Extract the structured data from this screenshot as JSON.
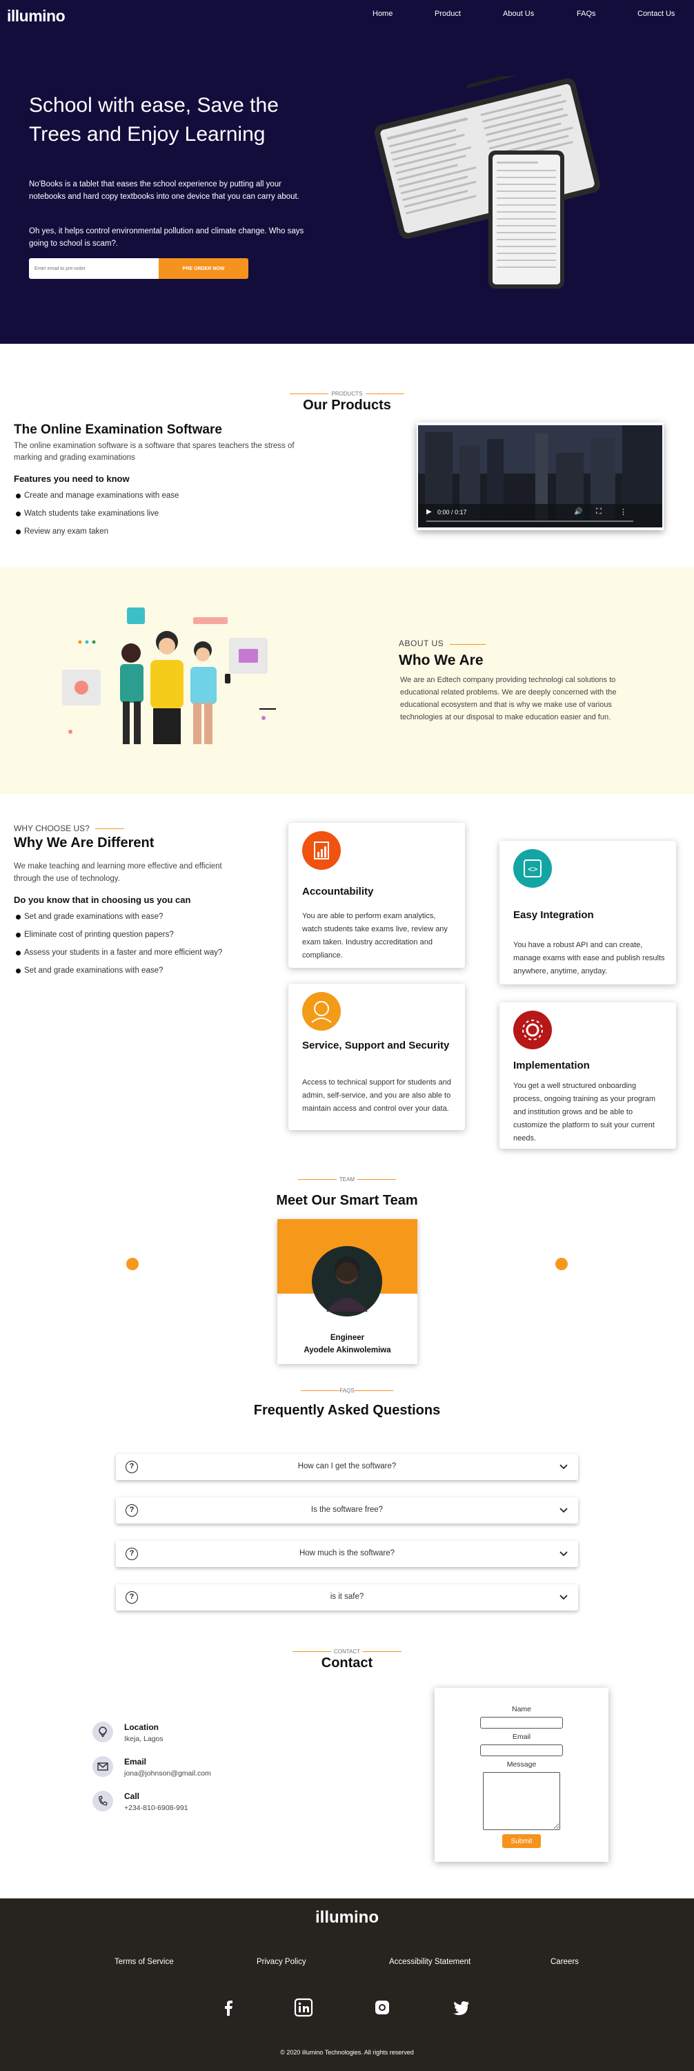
{
  "nav": {
    "logo": "illumino",
    "links": [
      "Home",
      "Product",
      "About Us",
      "FAQs",
      "Contact Us"
    ]
  },
  "hero": {
    "title": "School with ease, Save the Trees and Enjoy Learning",
    "paragraph1": "No'Books is a tablet that eases the school experience by putting all your notebooks and hard copy textbooks into one device that you can carry about.",
    "paragraph2": "Oh yes, it helps control environmental pollution and climate change. Who says going to school is scam?.",
    "input_placeholder": "Enter email to pre-order",
    "button_label": "PRE ORDER NOW"
  },
  "products": {
    "small": "PRODUCTS",
    "title": "Our Products",
    "heading": "The Online Examination Software",
    "description": "The online examination software is a software that spares teachers the stress of marking and grading examinations",
    "features_heading": "Features you need to know",
    "features": [
      "Create and manage examinations with ease",
      "Watch students take examinations live",
      "Review any exam taken"
    ],
    "video_time": "0:00 / 0:17"
  },
  "about": {
    "small": "ABOUT US",
    "title": "Who We Are",
    "paragraph": "We are an Edtech company providing technologi cal solutions to educational related problems. We are deeply concerned with the educational ecosystem and that is why we make use of various technologies at our disposal to make education easier and fun."
  },
  "why": {
    "small": "WHY CHOOSE US?",
    "title": "Why We Are Different",
    "paragraph": "We make teaching and learning more effective and efficient through the use of technology.",
    "question": "Do you know that in choosing us you can",
    "items": [
      "Set and grade examinations with ease?",
      "Eliminate cost of printing question papers?",
      "Assess your students in a faster and more efficient way?",
      "Set and grade examinations with ease?"
    ],
    "cards": [
      {
        "title": "Accountability",
        "text": "You are able to perform exam analytics, watch students take exams live, review any exam taken. Industry accreditation and compliance.",
        "color": "#f0520f"
      },
      {
        "title": "Easy Integration",
        "text": "You have a robust API and can create, manage exams with ease and publish results anywhere, anytime, anyday.",
        "color": "#13a5a3"
      },
      {
        "title": "Service, Support and Security",
        "text": "Access to technical support for students and admin, self-service, and you are also able to maintain access and control over your data.",
        "color": "#f39a16"
      },
      {
        "title": "Implementation",
        "text": "You get a well structured onboarding process, ongoing training as your program and institution grows and be able to customize the platform to suit your current needs.",
        "color": "#b81717"
      }
    ]
  },
  "team": {
    "small": "TEAM",
    "title": "Meet Our Smart Team",
    "role": "Engineer",
    "name": "Ayodele Akinwolemiwa"
  },
  "faq": {
    "small": "FAQS",
    "title": "Frequently Asked Questions",
    "questions": [
      "How can I get the software?",
      "Is the software free?",
      "How much is the software?",
      "is it safe?"
    ]
  },
  "contact": {
    "small": "CONTACT",
    "title": "Contact",
    "location_label": "Location",
    "location_value": "Ikeja, Lagos",
    "email_label": "Email",
    "email_value": "jona@johnson@gmail.com",
    "call_label": "Call",
    "call_value": "+234-810-6908-991",
    "form": {
      "name": "Name",
      "email": "Email",
      "message": "Message",
      "submit": "Submit"
    }
  },
  "footer": {
    "logo": "illumino",
    "links": [
      "Terms of Service",
      "Privacy Policy",
      "Accessibility Statement",
      "Careers"
    ],
    "copyright": "© 2020 illumino Technologies. All rights reserved"
  },
  "colors": {
    "hero_bg": "#130d3c",
    "accent": "#f6921e",
    "about_bg": "#fdfae6",
    "footer_bg": "#272420"
  }
}
